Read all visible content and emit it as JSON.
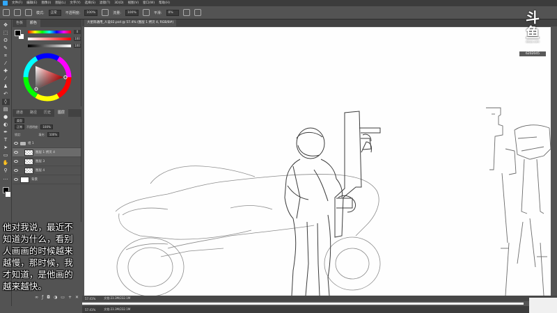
{
  "menubar": {
    "items": [
      "文件(F)",
      "编辑(E)",
      "图像(I)",
      "图层(L)",
      "文字(Y)",
      "选择(S)",
      "滤镜(T)",
      "3D(D)",
      "视图(V)",
      "窗口(W)",
      "帮助(H)"
    ]
  },
  "options": {
    "mode_label": "模式:",
    "mode_value": "正常",
    "opacity_label": "不透明度:",
    "opacity_value": "100%",
    "flow_label": "流量:",
    "flow_value": "100%",
    "smooth_label": "平滑:",
    "smooth_value": "0%"
  },
  "color_panel": {
    "tabs": [
      "色板",
      "颜色"
    ],
    "slider_values": [
      "0",
      "100",
      "100"
    ]
  },
  "layers_panel": {
    "tabs": [
      "通道",
      "路径",
      "历史",
      "图层"
    ],
    "kind_label": "类型",
    "blend_mode": "正常",
    "opacity_label": "不透明度:",
    "opacity_value": "100%",
    "lock_label": "锁定:",
    "fill_label": "填充:",
    "fill_value": "100%",
    "layers": [
      {
        "name": "组 1",
        "type": "group"
      },
      {
        "name": "图层 1 拷贝 4",
        "type": "layer",
        "selected": true
      },
      {
        "name": "图层 3",
        "type": "layer"
      },
      {
        "name": "图层 4",
        "type": "layer"
      },
      {
        "name": "背景",
        "type": "background"
      }
    ]
  },
  "document": {
    "tab_title": "大星际通用_人设02.psd @ 57.4% (图层 1 拷贝 4, RGB/8#)"
  },
  "status": {
    "zoom_1": "57.41%",
    "doc_1": "文档:23.3M/232.1M",
    "zoom_2": "57.41%",
    "doc_2": "文档:23.3M/232.1M"
  },
  "subtitle": {
    "text": "他对我说，最近不\n知道为什么，看别\n人画画的时候越来\n越慢，那时候，我\n才知道，是他画的\n越来越快。"
  },
  "watermark": {
    "logo": "斗鱼",
    "sub": "douyu.com",
    "room_id": "6202045"
  },
  "icons": {
    "toolbar": [
      "move-icon",
      "marquee-icon",
      "lasso-icon",
      "quick-select-icon",
      "crop-icon",
      "eyedropper-icon",
      "healing-icon",
      "brush-icon",
      "stamp-icon",
      "history-brush-icon",
      "eraser-icon",
      "gradient-icon",
      "blur-icon",
      "dodge-icon",
      "pen-icon",
      "type-icon",
      "path-select-icon",
      "shape-icon",
      "hand-icon",
      "zoom-icon"
    ]
  }
}
